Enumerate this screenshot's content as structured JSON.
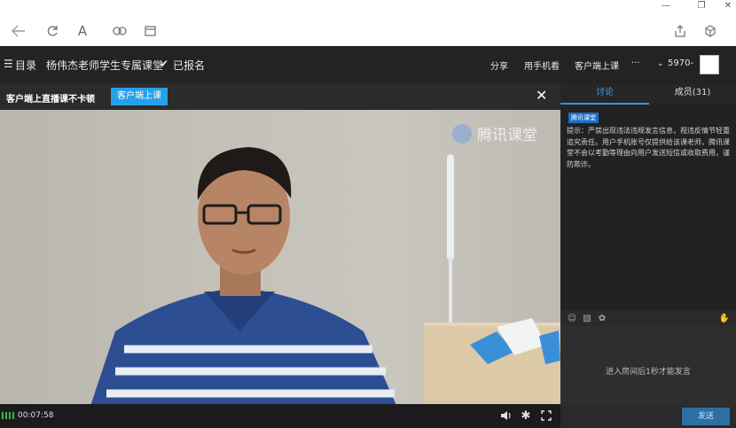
{
  "toolbar": {
    "back_icon": "back-arrow-icon",
    "refresh_icon": "refresh-icon",
    "font_icon": "font-icon",
    "link_icon": "link-icon",
    "window_icon": "window-icon",
    "share_icon": "share-icon",
    "cube_icon": "cube-icon"
  },
  "course": {
    "menu_label": "目录",
    "title": "杨伟杰老师学生专属课堂",
    "enrolled_label": "已报名",
    "share_label": "分享",
    "phone_label": "用手机看",
    "client_label": "客户端上课",
    "more_label": "···",
    "user_label": "5970-"
  },
  "notice": {
    "text": "客户端上直播课不卡顿",
    "button_label": "客户端上课"
  },
  "video": {
    "watermark": "腾讯课堂",
    "elapsed": "00:07:58"
  },
  "side": {
    "tabs": [
      {
        "label": "讨论",
        "active": true
      },
      {
        "label": "成员(31)",
        "active": false
      }
    ],
    "badge": "腾讯课堂",
    "tip": "提示：严禁出现违法违规发言信息，视违反情节轻重追究责任。用户手机账号仅提供给该课老师，腾讯课堂不会以考勤等理由向用户发送短信或收取费用，谨防欺诈。",
    "input_hint": "进入房间后1秒才能发言",
    "send_label": "发送"
  },
  "colors": {
    "accent": "#25a0e9",
    "tab_active": "#4aa3ef",
    "send_bg": "#2d6fa3"
  }
}
